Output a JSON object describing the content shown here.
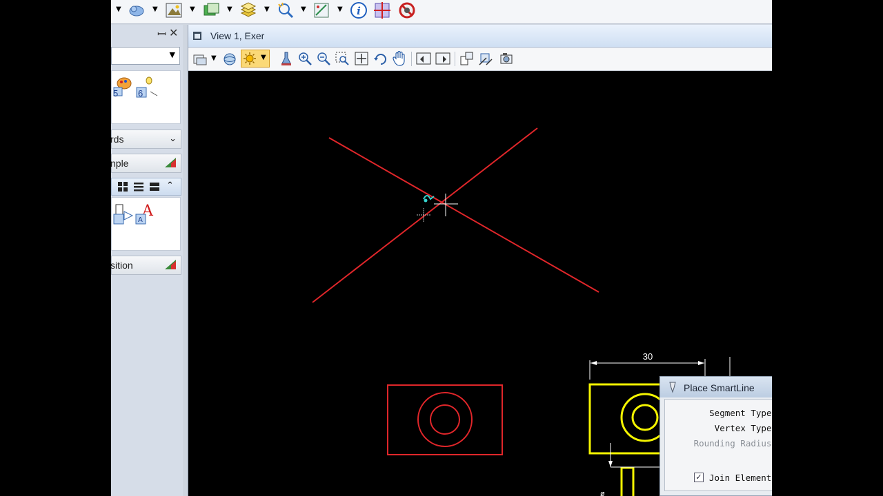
{
  "view_window": {
    "title": "View 1, Exer"
  },
  "left_panel": {
    "sections": [
      {
        "label": "rds"
      },
      {
        "label": "nple"
      },
      {
        "label": "sition"
      }
    ],
    "combo_value": "",
    "tool_digits": [
      "5",
      "6"
    ]
  },
  "drawing": {
    "dimension_value": "30",
    "partial_dimension": "ø"
  },
  "dialog": {
    "title": "Place SmartLine",
    "segment_type_label": "Segment Type:",
    "vertex_type_label": "Vertex Type:",
    "rounding_radius_label": "Rounding Radius:",
    "join_elements_label": "Join Elements",
    "join_elements_checked": true,
    "check_glyph": "✓"
  },
  "colors": {
    "canvas_bg": "#000000",
    "red_geometry": "#e0262a",
    "yellow_geometry": "#f5f500",
    "dimension_white": "#ffffff",
    "cursor_cyan": "#36d6d0"
  }
}
